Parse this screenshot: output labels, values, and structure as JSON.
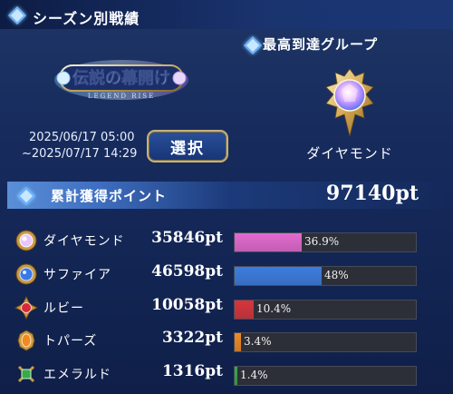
{
  "header": {
    "title": "シーズン別戦績"
  },
  "season": {
    "logo_text": "伝説の幕開け",
    "logo_subtext": "LEGEND RISE",
    "date_start": "2025/06/17 05:00",
    "date_end": "~2025/07/17 14:29",
    "select_label": "選択"
  },
  "group": {
    "title": "最高到達グループ",
    "name": "ダイヤモンド",
    "icon": "diamond-gem-icon"
  },
  "points": {
    "label": "累計獲得ポイント",
    "total": "97140pt"
  },
  "breakdown": [
    {
      "name": "ダイヤモンド",
      "points": "35846pt",
      "percent_label": "36.9%",
      "fraction": 0.369,
      "color": "#e56ad0",
      "icon": "diamond-gem-icon"
    },
    {
      "name": "サファイア",
      "points": "46598pt",
      "percent_label": "48%",
      "fraction": 0.48,
      "color": "#3b7de0",
      "icon": "sapphire-gem-icon"
    },
    {
      "name": "ルビー",
      "points": "10058pt",
      "percent_label": "10.4%",
      "fraction": 0.104,
      "color": "#d8343a",
      "icon": "ruby-gem-icon"
    },
    {
      "name": "トパーズ",
      "points": "3322pt",
      "percent_label": "3.4%",
      "fraction": 0.034,
      "color": "#f08a22",
      "icon": "topaz-gem-icon"
    },
    {
      "name": "エメラルド",
      "points": "1316pt",
      "percent_label": "1.4%",
      "fraction": 0.014,
      "color": "#3aa84a",
      "icon": "emerald-gem-icon"
    }
  ]
}
